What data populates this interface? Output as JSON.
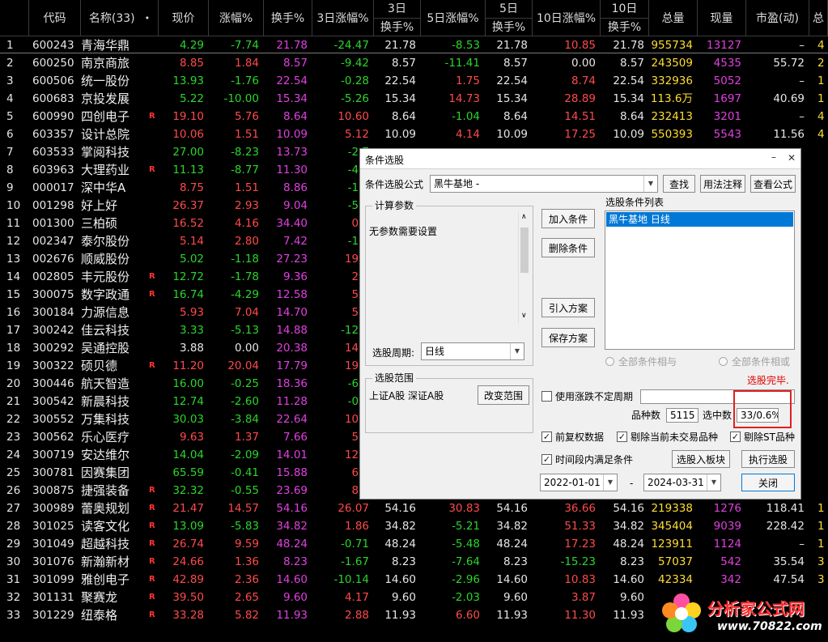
{
  "columns": [
    {
      "label": "代码"
    },
    {
      "label": "名称(33)",
      "icon": "dot-indicator"
    },
    {
      "label": "现价"
    },
    {
      "label": "涨幅%"
    },
    {
      "label": "换手%"
    },
    {
      "label": "3日涨幅%"
    },
    {
      "label_top": "3日",
      "label_bottom": "换手%"
    },
    {
      "label": "5日涨幅%"
    },
    {
      "label_top": "5日",
      "label_bottom": "换手%"
    },
    {
      "label": "10日涨幅%"
    },
    {
      "label_top": "10日",
      "label_bottom": "换手%"
    },
    {
      "label": "总量"
    },
    {
      "label": "现量"
    },
    {
      "label": "市盈(动)"
    },
    {
      "label": "总"
    }
  ],
  "dot": "•",
  "rows": [
    {
      "idx": "1",
      "code": "600243",
      "name": "青海华鼎",
      "r": "",
      "price": "4.29",
      "chg": "-7.74",
      "turn": "21.78",
      "chg3": "-24.47",
      "turn3": "21.78",
      "chg5": "-8.53",
      "turn5": "21.78",
      "chg10": "10.85",
      "turn10": "21.78",
      "vol": "955734",
      "cur": "13127",
      "pe": "–",
      "tail": "4"
    },
    {
      "idx": "2",
      "code": "600250",
      "name": "南京商旅",
      "r": "",
      "price": "8.85",
      "chg": "1.84",
      "turn": "8.57",
      "chg3": "-9.42",
      "turn3": "8.57",
      "chg5": "-11.41",
      "turn5": "8.57",
      "chg10": "0.00",
      "turn10": "8.57",
      "vol": "243509",
      "cur": "4535",
      "pe": "55.72",
      "tail": "2"
    },
    {
      "idx": "3",
      "code": "600506",
      "name": "统一股份",
      "r": "",
      "price": "13.93",
      "chg": "-1.76",
      "turn": "22.54",
      "chg3": "-0.28",
      "turn3": "22.54",
      "chg5": "1.75",
      "turn5": "22.54",
      "chg10": "8.74",
      "turn10": "22.54",
      "vol": "332936",
      "cur": "5052",
      "pe": "–",
      "tail": "1"
    },
    {
      "idx": "4",
      "code": "600683",
      "name": "京投发展",
      "r": "",
      "price": "5.22",
      "chg": "-10.00",
      "turn": "15.34",
      "chg3": "-5.26",
      "turn3": "15.34",
      "chg5": "14.73",
      "turn5": "15.34",
      "chg10": "28.89",
      "turn10": "15.34",
      "vol": "113.6万",
      "cur": "1697",
      "pe": "40.69",
      "tail": "1"
    },
    {
      "idx": "5",
      "code": "600990",
      "name": "四创电子",
      "r": "R",
      "price": "19.10",
      "chg": "5.76",
      "turn": "8.64",
      "chg3": "10.60",
      "turn3": "8.64",
      "chg5": "-1.04",
      "turn5": "8.64",
      "chg10": "14.51",
      "turn10": "8.64",
      "vol": "232413",
      "cur": "3201",
      "pe": "–",
      "tail": "4"
    },
    {
      "idx": "6",
      "code": "603357",
      "name": "设计总院",
      "r": "",
      "price": "10.06",
      "chg": "1.51",
      "turn": "10.09",
      "chg3": "5.12",
      "turn3": "10.09",
      "chg5": "4.14",
      "turn5": "10.09",
      "chg10": "17.25",
      "turn10": "10.09",
      "vol": "550393",
      "cur": "5543",
      "pe": "11.56",
      "tail": "4"
    },
    {
      "idx": "7",
      "code": "603533",
      "name": "掌阅科技",
      "r": "",
      "price": "27.00",
      "chg": "-8.23",
      "turn": "13.73",
      "chg3": "-2.7",
      "turn3": "",
      "chg5": "",
      "turn5": "",
      "chg10": "",
      "turn10": "",
      "vol": "",
      "cur": "",
      "pe": "",
      "tail": ""
    },
    {
      "idx": "8",
      "code": "603963",
      "name": "大理药业",
      "r": "R",
      "price": "11.13",
      "chg": "-8.77",
      "turn": "11.30",
      "chg3": "-4.3",
      "turn3": "",
      "chg5": "",
      "turn5": "",
      "chg10": "",
      "turn10": "",
      "vol": "",
      "cur": "",
      "pe": "",
      "tail": ""
    },
    {
      "idx": "9",
      "code": "000017",
      "name": "深中华A",
      "r": "",
      "price": "8.75",
      "chg": "1.51",
      "turn": "8.86",
      "chg3": "-1.6",
      "turn3": "",
      "chg5": "",
      "turn5": "",
      "chg10": "",
      "turn10": "",
      "vol": "",
      "cur": "",
      "pe": "",
      "tail": ""
    },
    {
      "idx": "10",
      "code": "001298",
      "name": "好上好",
      "r": "",
      "price": "26.37",
      "chg": "2.93",
      "turn": "9.04",
      "chg3": "-5.3",
      "turn3": "",
      "chg5": "",
      "turn5": "",
      "chg10": "",
      "turn10": "",
      "vol": "",
      "cur": "",
      "pe": "",
      "tail": ""
    },
    {
      "idx": "11",
      "code": "001300",
      "name": "三柏硕",
      "r": "",
      "price": "16.52",
      "chg": "4.16",
      "turn": "34.40",
      "chg3": "0.7",
      "turn3": "",
      "chg5": "",
      "turn5": "",
      "chg10": "",
      "turn10": "",
      "vol": "",
      "cur": "",
      "pe": "",
      "tail": ""
    },
    {
      "idx": "12",
      "code": "002347",
      "name": "泰尔股份",
      "r": "",
      "price": "5.14",
      "chg": "2.80",
      "turn": "7.42",
      "chg3": "-1.3",
      "turn3": "",
      "chg5": "",
      "turn5": "",
      "chg10": "",
      "turn10": "",
      "vol": "",
      "cur": "",
      "pe": "",
      "tail": ""
    },
    {
      "idx": "13",
      "code": "002676",
      "name": "顺威股份",
      "r": "",
      "price": "5.02",
      "chg": "-1.18",
      "turn": "27.23",
      "chg3": "19.5",
      "turn3": "",
      "chg5": "",
      "turn5": "",
      "chg10": "",
      "turn10": "",
      "vol": "",
      "cur": "",
      "pe": "",
      "tail": ""
    },
    {
      "idx": "14",
      "code": "002805",
      "name": "丰元股份",
      "r": "R",
      "price": "12.72",
      "chg": "-1.78",
      "turn": "9.36",
      "chg3": "2.1",
      "turn3": "",
      "chg5": "",
      "turn5": "",
      "chg10": "",
      "turn10": "",
      "vol": "",
      "cur": "",
      "pe": "",
      "tail": ""
    },
    {
      "idx": "15",
      "code": "300075",
      "name": "数字政通",
      "r": "R",
      "price": "16.74",
      "chg": "-4.29",
      "turn": "12.58",
      "chg3": "5.3",
      "turn3": "",
      "chg5": "",
      "turn5": "",
      "chg10": "",
      "turn10": "",
      "vol": "",
      "cur": "",
      "pe": "",
      "tail": ""
    },
    {
      "idx": "16",
      "code": "300184",
      "name": "力源信息",
      "r": "",
      "price": "5.93",
      "chg": "7.04",
      "turn": "14.70",
      "chg3": "5.5",
      "turn3": "",
      "chg5": "",
      "turn5": "",
      "chg10": "",
      "turn10": "",
      "vol": "",
      "cur": "",
      "pe": "",
      "tail": ""
    },
    {
      "idx": "17",
      "code": "300242",
      "name": "佳云科技",
      "r": "",
      "price": "3.33",
      "chg": "-5.13",
      "turn": "14.88",
      "chg3": "-12.1",
      "turn3": "",
      "chg5": "",
      "turn5": "",
      "chg10": "",
      "turn10": "",
      "vol": "",
      "cur": "",
      "pe": "",
      "tail": ""
    },
    {
      "idx": "18",
      "code": "300292",
      "name": "吴通控股",
      "r": "",
      "price": "3.88",
      "chg": "0.00",
      "turn": "20.38",
      "chg3": "14.4",
      "turn3": "",
      "chg5": "",
      "turn5": "",
      "chg10": "",
      "turn10": "",
      "vol": "",
      "cur": "",
      "pe": "",
      "tail": ""
    },
    {
      "idx": "19",
      "code": "300322",
      "name": "硕贝德",
      "r": "R",
      "price": "11.20",
      "chg": "20.04",
      "turn": "17.79",
      "chg3": "19.2",
      "turn3": "",
      "chg5": "",
      "turn5": "",
      "chg10": "",
      "turn10": "",
      "vol": "",
      "cur": "",
      "pe": "",
      "tail": ""
    },
    {
      "idx": "20",
      "code": "300446",
      "name": "航天智造",
      "r": "",
      "price": "16.00",
      "chg": "-0.25",
      "turn": "18.36",
      "chg3": "-6.1",
      "turn3": "",
      "chg5": "",
      "turn5": "",
      "chg10": "",
      "turn10": "",
      "vol": "",
      "cur": "",
      "pe": "",
      "tail": ""
    },
    {
      "idx": "21",
      "code": "300542",
      "name": "新晨科技",
      "r": "",
      "price": "12.74",
      "chg": "-2.60",
      "turn": "11.28",
      "chg3": "-0.4",
      "turn3": "",
      "chg5": "",
      "turn5": "",
      "chg10": "",
      "turn10": "",
      "vol": "",
      "cur": "",
      "pe": "",
      "tail": ""
    },
    {
      "idx": "22",
      "code": "300552",
      "name": "万集科技",
      "r": "",
      "price": "30.03",
      "chg": "-3.84",
      "turn": "22.64",
      "chg3": "10.3",
      "turn3": "",
      "chg5": "",
      "turn5": "",
      "chg10": "",
      "turn10": "",
      "vol": "",
      "cur": "",
      "pe": "",
      "tail": ""
    },
    {
      "idx": "23",
      "code": "300562",
      "name": "乐心医疗",
      "r": "",
      "price": "9.63",
      "chg": "1.37",
      "turn": "7.66",
      "chg3": "5.4",
      "turn3": "",
      "chg5": "",
      "turn5": "",
      "chg10": "",
      "turn10": "",
      "vol": "",
      "cur": "",
      "pe": "",
      "tail": ""
    },
    {
      "idx": "24",
      "code": "300719",
      "name": "安达维尔",
      "r": "",
      "price": "14.04",
      "chg": "-2.09",
      "turn": "14.01",
      "chg3": "12.8",
      "turn3": "",
      "chg5": "",
      "turn5": "",
      "chg10": "",
      "turn10": "",
      "vol": "",
      "cur": "",
      "pe": "",
      "tail": ""
    },
    {
      "idx": "25",
      "code": "300781",
      "name": "因赛集团",
      "r": "",
      "price": "65.59",
      "chg": "-0.41",
      "turn": "15.88",
      "chg3": "6.1",
      "turn3": "",
      "chg5": "",
      "turn5": "",
      "chg10": "",
      "turn10": "",
      "vol": "",
      "cur": "",
      "pe": "",
      "tail": ""
    },
    {
      "idx": "26",
      "code": "300875",
      "name": "捷强装备",
      "r": "R",
      "price": "32.32",
      "chg": "-0.55",
      "turn": "23.69",
      "chg3": "8.4",
      "turn3": "",
      "chg5": "",
      "turn5": "",
      "chg10": "",
      "turn10": "",
      "vol": "",
      "cur": "",
      "pe": "",
      "tail": ""
    },
    {
      "idx": "27",
      "code": "300989",
      "name": "蕾奥规划",
      "r": "R",
      "price": "21.47",
      "chg": "14.57",
      "turn": "54.16",
      "chg3": "26.07",
      "turn3": "54.16",
      "chg5": "30.83",
      "turn5": "54.16",
      "chg10": "36.66",
      "turn10": "54.16",
      "vol": "219338",
      "cur": "1276",
      "pe": "118.41",
      "tail": "1"
    },
    {
      "idx": "28",
      "code": "301025",
      "name": "读客文化",
      "r": "R",
      "price": "13.09",
      "chg": "-5.83",
      "turn": "34.82",
      "chg3": "1.86",
      "turn3": "34.82",
      "chg5": "-5.21",
      "turn5": "34.82",
      "chg10": "51.33",
      "turn10": "34.82",
      "vol": "345404",
      "cur": "9039",
      "pe": "228.42",
      "tail": "1"
    },
    {
      "idx": "29",
      "code": "301049",
      "name": "超越科技",
      "r": "R",
      "price": "26.74",
      "chg": "9.59",
      "turn": "48.24",
      "chg3": "-0.71",
      "turn3": "48.24",
      "chg5": "-5.48",
      "turn5": "48.24",
      "chg10": "17.23",
      "turn10": "48.24",
      "vol": "123911",
      "cur": "1124",
      "pe": "–",
      "tail": "1"
    },
    {
      "idx": "30",
      "code": "301076",
      "name": "新瀚新材",
      "r": "R",
      "price": "24.66",
      "chg": "1.36",
      "turn": "8.23",
      "chg3": "-1.67",
      "turn3": "8.23",
      "chg5": "-7.64",
      "turn5": "8.23",
      "chg10": "-15.23",
      "turn10": "8.23",
      "vol": "57037",
      "cur": "542",
      "pe": "35.54",
      "tail": "3"
    },
    {
      "idx": "31",
      "code": "301099",
      "name": "雅创电子",
      "r": "R",
      "price": "42.89",
      "chg": "2.36",
      "turn": "14.60",
      "chg3": "-10.14",
      "turn3": "14.60",
      "chg5": "-2.96",
      "turn5": "14.60",
      "chg10": "10.83",
      "turn10": "14.60",
      "vol": "42334",
      "cur": "342",
      "pe": "47.54",
      "tail": "3"
    },
    {
      "idx": "32",
      "code": "301131",
      "name": "聚赛龙",
      "r": "R",
      "price": "39.50",
      "chg": "2.65",
      "turn": "9.60",
      "chg3": "4.17",
      "turn3": "9.60",
      "chg5": "-2.03",
      "turn5": "9.60",
      "chg10": "3.87",
      "turn10": "9.60",
      "vol": "",
      "cur": "",
      "pe": "",
      "tail": ""
    },
    {
      "idx": "33",
      "code": "301229",
      "name": "纽泰格",
      "r": "R",
      "price": "33.28",
      "chg": "5.82",
      "turn": "11.93",
      "chg3": "2.88",
      "turn3": "11.93",
      "chg5": "6.60",
      "turn5": "11.93",
      "chg10": "11.30",
      "turn10": "11.93",
      "vol": "",
      "cur": "",
      "pe": "",
      "tail": ""
    }
  ],
  "dialog": {
    "title": "条件选股",
    "minimize": "–",
    "close": "✕",
    "formula_label": "条件选股公式",
    "formula_value": "黑牛基地  -",
    "find_btn": "查找",
    "usage_btn": "用法注释",
    "view_btn": "查看公式",
    "calc_group": "计算参数",
    "no_param": "无参数需要设置",
    "add_btn": "加入条件",
    "del_btn": "删除条件",
    "import_btn": "引入方案",
    "save_btn": "保存方案",
    "list_title": "选股条件列表",
    "list_items": [
      "黑牛基地  日线"
    ],
    "and_label": "全部条件相与",
    "or_label": "全部条件相或",
    "period_label": "选股周期:",
    "period_value": "日线",
    "done_text": "选股完毕.",
    "range_group": "选股范围",
    "range_value": "上证A股 深证A股",
    "change_range_btn": "改变范围",
    "use_period_label": "使用涨跌不定周期",
    "count_label": "品种数",
    "count_value": "5115",
    "selected_label": "选中数",
    "selected_value": "33/0.6%",
    "fq_label": "前复权数据",
    "remove_untraded_label": "剔除当前未交易品种",
    "remove_st_label": "剔除ST品种",
    "time_label": "时间段内满足条件",
    "to_block_btn": "选股入板块",
    "run_btn": "执行选股",
    "date_from": "2022-01-01",
    "date_sep": "-",
    "date_to": "2024-03-31",
    "close_btn": "关闭",
    "check_mark": "✓",
    "arrow_down": "▼",
    "arrow_up": "∧",
    "arrow_dn2": "∨"
  },
  "watermark": {
    "text_cn": "分析家公式网",
    "url": "www.70822.com"
  }
}
